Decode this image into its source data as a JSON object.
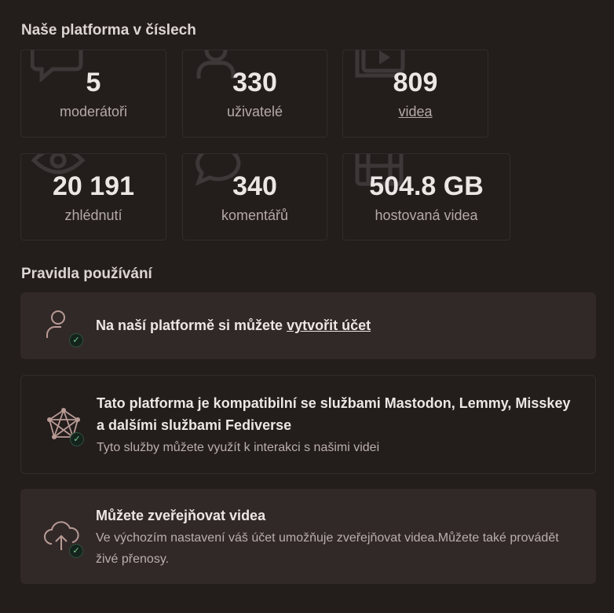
{
  "stats_section": {
    "title": "Naše platforma v číslech",
    "items": [
      {
        "value": "5",
        "label": "moderátoři",
        "icon": "chat-icon"
      },
      {
        "value": "330",
        "label": "uživatelé",
        "icon": "user-icon"
      },
      {
        "value": "809",
        "label": "videa",
        "icon": "video-library-icon"
      },
      {
        "value": "20 191",
        "label": "zhlédnutí",
        "icon": "eye-icon"
      },
      {
        "value": "340",
        "label": "komentářů",
        "icon": "comment-icon"
      },
      {
        "value": "504.8 GB",
        "label": "hostovaná videa",
        "icon": "film-icon"
      }
    ]
  },
  "rules_section": {
    "title": "Pravidla používání",
    "rules": [
      {
        "title_prefix": "Na naší platformě si můžete ",
        "title_link": "vytvořit účet",
        "icon": "user-account-icon"
      },
      {
        "title": "Tato platforma je kompatibilní se službami Mastodon, Lemmy, Misskey a dalšími službami Fediverse",
        "description": "Tyto služby můžete využít k interakci s našimi videi",
        "icon": "fediverse-icon"
      },
      {
        "title": "Můžete zveřejňovat videa",
        "description": "Ve výchozím nastavení váš účet umožňuje zveřejňovat videa.Můžete také provádět živé přenosy.",
        "icon": "upload-cloud-icon"
      }
    ]
  },
  "colors": {
    "background": "#231d1c",
    "card_fill": "#312928",
    "check_accent": "#7fcf98"
  }
}
